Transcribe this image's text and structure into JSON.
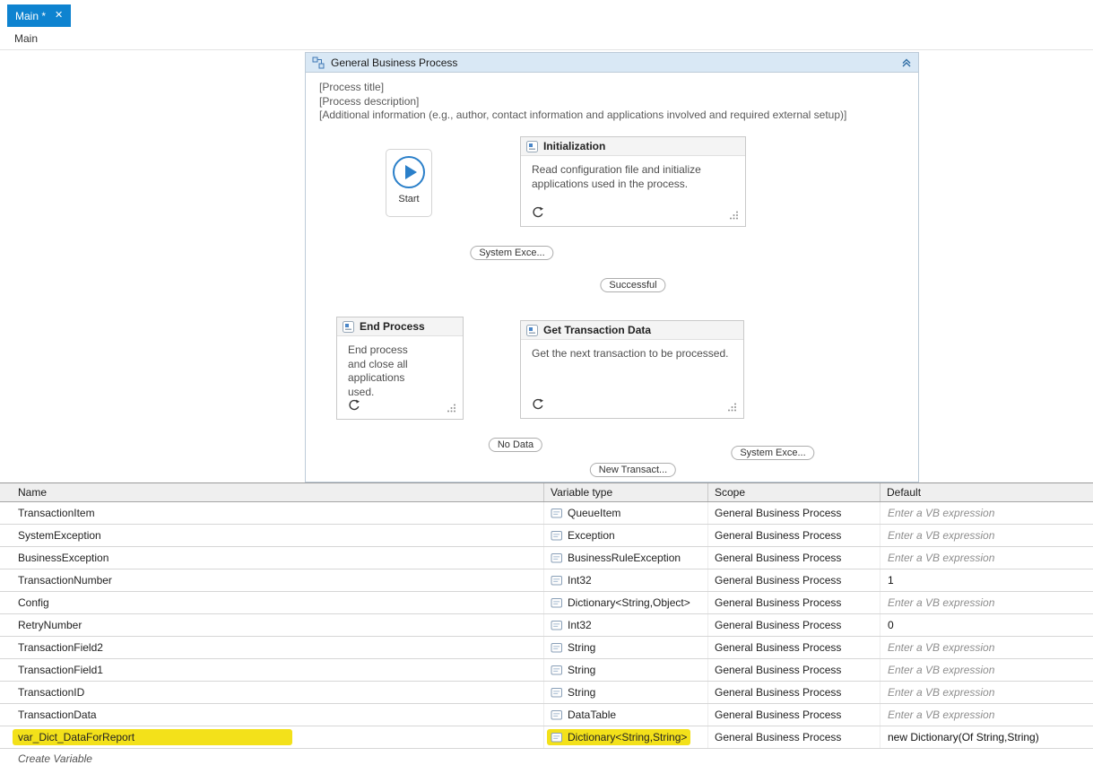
{
  "window": {
    "tab_label": "Main *",
    "tab_close": "✕",
    "breadcrumb": "Main"
  },
  "canvas": {
    "container_title": "General Business Process",
    "process_title_placeholder": "[Process title]",
    "process_description_placeholder": "[Process description]",
    "process_additional_placeholder": "[Additional information (e.g., author, contact information and applications involved and required external setup)]",
    "start_label": "Start",
    "activities": {
      "initialization": {
        "title": "Initialization",
        "description": "Read configuration file and initialize applications used in the process."
      },
      "end_process": {
        "title": "End Process",
        "description": "End process and close all applications used."
      },
      "get_transaction_data": {
        "title": "Get Transaction Data",
        "description": "Get the next transaction to be processed."
      }
    },
    "labels": {
      "system_exception_top": "System Exce...",
      "successful": "Successful",
      "no_data": "No Data",
      "new_transaction": "New Transact...",
      "system_exception_right": "System Exce..."
    }
  },
  "variables_panel": {
    "columns": {
      "name": "Name",
      "type": "Variable type",
      "scope": "Scope",
      "default": "Default"
    },
    "rows": [
      {
        "name": "TransactionItem",
        "type": "QueueItem",
        "scope": "General Business Process",
        "default": "Enter a VB expression",
        "is_placeholder": true,
        "highlight": false
      },
      {
        "name": "SystemException",
        "type": "Exception",
        "scope": "General Business Process",
        "default": "Enter a VB expression",
        "is_placeholder": true,
        "highlight": false
      },
      {
        "name": "BusinessException",
        "type": "BusinessRuleException",
        "scope": "General Business Process",
        "default": "Enter a VB expression",
        "is_placeholder": true,
        "highlight": false
      },
      {
        "name": "TransactionNumber",
        "type": "Int32",
        "scope": "General Business Process",
        "default": "1",
        "is_placeholder": false,
        "highlight": false
      },
      {
        "name": "Config",
        "type": "Dictionary<String,Object>",
        "scope": "General Business Process",
        "default": "Enter a VB expression",
        "is_placeholder": true,
        "highlight": false
      },
      {
        "name": "RetryNumber",
        "type": "Int32",
        "scope": "General Business Process",
        "default": "0",
        "is_placeholder": false,
        "highlight": false
      },
      {
        "name": "TransactionField2",
        "type": "String",
        "scope": "General Business Process",
        "default": "Enter a VB expression",
        "is_placeholder": true,
        "highlight": false
      },
      {
        "name": "TransactionField1",
        "type": "String",
        "scope": "General Business Process",
        "default": "Enter a VB expression",
        "is_placeholder": true,
        "highlight": false
      },
      {
        "name": "TransactionID",
        "type": "String",
        "scope": "General Business Process",
        "default": "Enter a VB expression",
        "is_placeholder": true,
        "highlight": false
      },
      {
        "name": "TransactionData",
        "type": "DataTable",
        "scope": "General Business Process",
        "default": "Enter a VB expression",
        "is_placeholder": true,
        "highlight": false
      },
      {
        "name": "var_Dict_DataForReport",
        "type": "Dictionary<String,String>",
        "scope": "General Business Process",
        "default": "new Dictionary(Of String,String)",
        "is_placeholder": false,
        "highlight": true
      }
    ],
    "create_variable": "Create Variable"
  },
  "colors": {
    "tab_blue": "#0e83d0",
    "header_light_blue": "#d9e8f5",
    "highlight_yellow": "#f3e11a",
    "connector_gray": "#9d9d9d",
    "start_blue": "#2a7fc9"
  }
}
